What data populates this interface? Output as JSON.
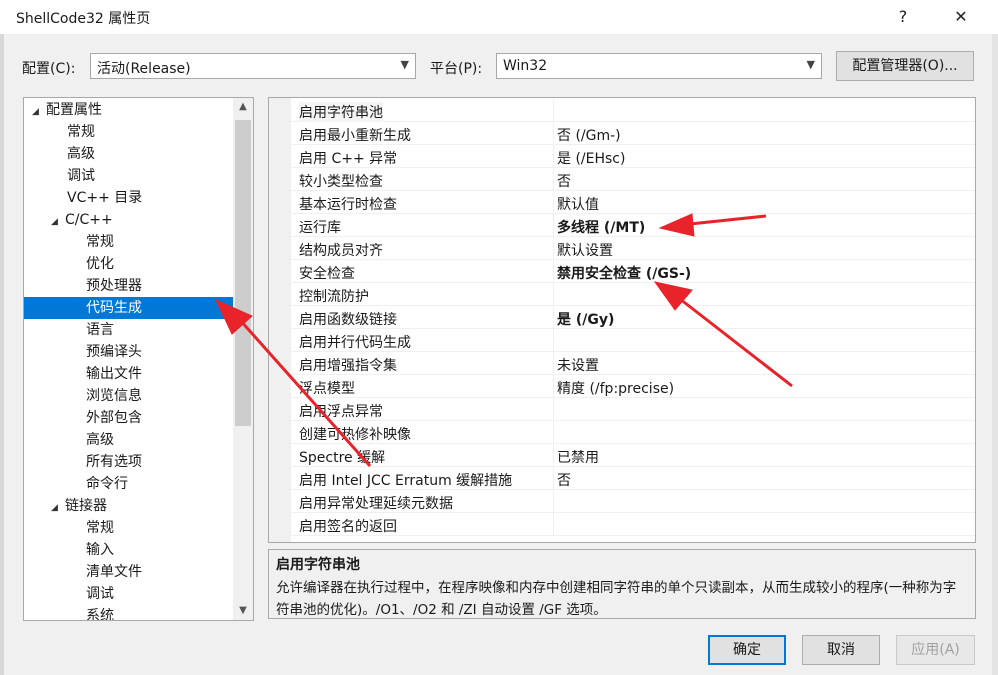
{
  "window": {
    "title": "ShellCode32 属性页",
    "help_label": "?",
    "close_label": "✕"
  },
  "config": {
    "label": "配置(C):",
    "value": "活动(Release)"
  },
  "platform": {
    "label": "平台(P):",
    "value": "Win32"
  },
  "config_manager_label": "配置管理器(O)...",
  "tree": [
    {
      "label": "配置属性",
      "toggle": "◢"
    },
    {
      "label": "常规"
    },
    {
      "label": "高级"
    },
    {
      "label": "调试"
    },
    {
      "label": "VC++ 目录"
    },
    {
      "label": "C/C++",
      "toggle": "◢"
    },
    {
      "label": "常规"
    },
    {
      "label": "优化"
    },
    {
      "label": "预处理器"
    },
    {
      "label": "代码生成",
      "selected": true
    },
    {
      "label": "语言"
    },
    {
      "label": "预编译头"
    },
    {
      "label": "输出文件"
    },
    {
      "label": "浏览信息"
    },
    {
      "label": "外部包含"
    },
    {
      "label": "高级"
    },
    {
      "label": "所有选项"
    },
    {
      "label": "命令行"
    },
    {
      "label": "链接器",
      "toggle": "◢"
    },
    {
      "label": "常规"
    },
    {
      "label": "输入"
    },
    {
      "label": "清单文件"
    },
    {
      "label": "调试"
    },
    {
      "label": "系统"
    }
  ],
  "properties": [
    {
      "name": "启用字符串池",
      "value": ""
    },
    {
      "name": "启用最小重新生成",
      "value": "否 (/Gm-)"
    },
    {
      "name": "启用 C++ 异常",
      "value": "是 (/EHsc)"
    },
    {
      "name": "较小类型检查",
      "value": "否"
    },
    {
      "name": "基本运行时检查",
      "value": "默认值"
    },
    {
      "name": "运行库",
      "value": "多线程 (/MT)",
      "bold": true
    },
    {
      "name": "结构成员对齐",
      "value": "默认设置"
    },
    {
      "name": "安全检查",
      "value": "禁用安全检查 (/GS-)",
      "bold": true
    },
    {
      "name": "控制流防护",
      "value": ""
    },
    {
      "name": "启用函数级链接",
      "value": "是 (/Gy)",
      "bold": true
    },
    {
      "name": "启用并行代码生成",
      "value": ""
    },
    {
      "name": "启用增强指令集",
      "value": "未设置"
    },
    {
      "name": "浮点模型",
      "value": "精度 (/fp:precise)"
    },
    {
      "name": "启用浮点异常",
      "value": ""
    },
    {
      "name": "创建可热修补映像",
      "value": ""
    },
    {
      "name": "Spectre 缓解",
      "value": "已禁用"
    },
    {
      "name": "启用 Intel JCC Erratum 缓解措施",
      "value": "否"
    },
    {
      "name": "启用异常处理延续元数据",
      "value": ""
    },
    {
      "name": "启用签名的返回",
      "value": ""
    }
  ],
  "description": {
    "title": "启用字符串池",
    "text": "允许编译器在执行过程中，在程序映像和内存中创建相同字符串的单个只读副本，从而生成较小的程序(一种称为字符串池的优化)。/O1、/O2 和 /ZI 自动设置 /GF 选项。"
  },
  "buttons": {
    "ok": "确定",
    "cancel": "取消",
    "apply": "应用(A)"
  },
  "colors": {
    "selection": "#0078d7",
    "arrow": "#e8232a"
  }
}
